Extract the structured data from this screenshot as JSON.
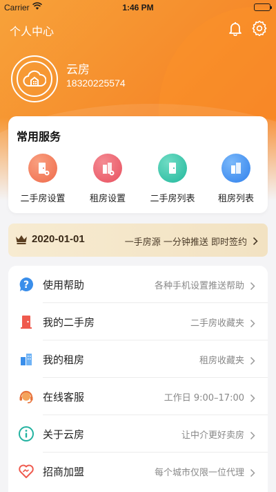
{
  "status_bar": {
    "carrier": "Carrier",
    "time": "1:46 PM"
  },
  "header": {
    "title": "个人中心"
  },
  "profile": {
    "name": "云房",
    "phone": "18320225574"
  },
  "services": {
    "title": "常用服务",
    "items": [
      {
        "label": "二手房设置",
        "icon": "door-settings-icon",
        "color": "#f0734e"
      },
      {
        "label": "租房设置",
        "icon": "building-settings-icon",
        "color": "#ee5a6b"
      },
      {
        "label": "二手房列表",
        "icon": "door-list-icon",
        "color": "#2ec2a7"
      },
      {
        "label": "租房列表",
        "icon": "building-list-icon",
        "color": "#3b8df0"
      }
    ]
  },
  "vip": {
    "date": "2020-01-01",
    "desc": "一手房源 一分钟推送 即时签约"
  },
  "menu": [
    {
      "title": "使用帮助",
      "sub": "各种手机设置推送帮助",
      "icon": "help-icon"
    },
    {
      "title": "我的二手房",
      "sub": "二手房收藏夹",
      "icon": "door-icon"
    },
    {
      "title": "我的租房",
      "sub": "租房收藏夹",
      "icon": "building-icon"
    },
    {
      "title": "在线客服",
      "sub": "工作日 9:00–17:00",
      "icon": "headset-icon"
    },
    {
      "title": "关于云房",
      "sub": "让中介更好卖房",
      "icon": "info-icon"
    },
    {
      "title": "招商加盟",
      "sub": "每个城市仅限一位代理",
      "icon": "handshake-icon"
    }
  ],
  "colors": {
    "accent": "#f68a2a",
    "vip_bg": "#f4e6c9"
  }
}
